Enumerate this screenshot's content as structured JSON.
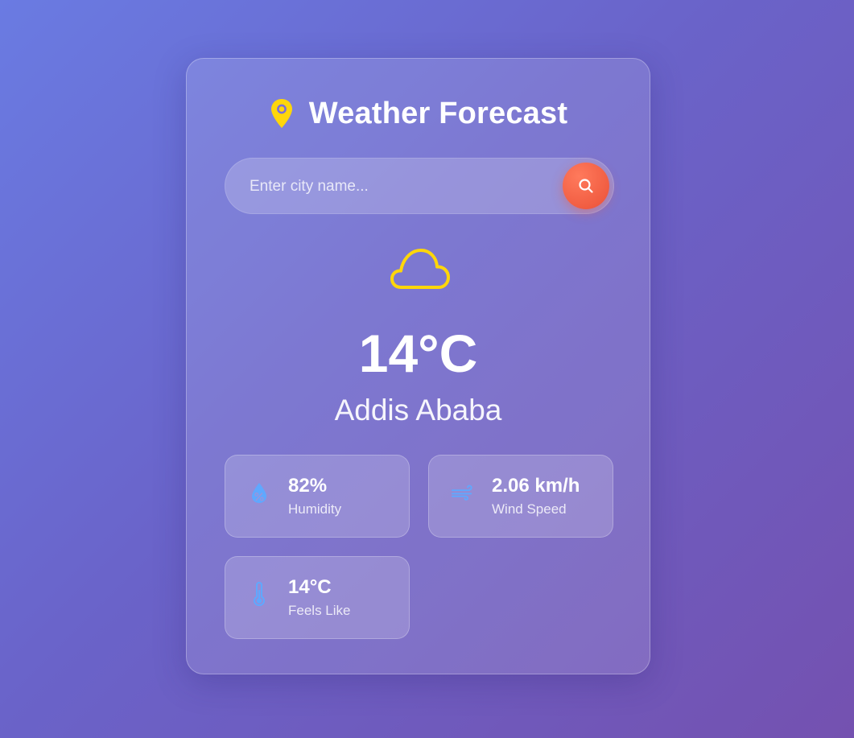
{
  "header": {
    "title": "Weather Forecast",
    "icon": "map-pin-icon",
    "icon_color": "#ffd60a"
  },
  "search": {
    "placeholder": "Enter city name...",
    "value": "",
    "button_icon": "search-icon",
    "button_color": "#f15d42"
  },
  "weather": {
    "condition_icon": "cloud-icon",
    "icon_color": "#ffd60a",
    "temperature": "14°C",
    "city": "Addis Ababa"
  },
  "stats": {
    "humidity": {
      "value": "82%",
      "label": "Humidity",
      "icon": "humidity-drop-icon"
    },
    "wind": {
      "value": "2.06 km/h",
      "label": "Wind Speed",
      "icon": "wind-icon"
    },
    "feels_like": {
      "value": "14°C",
      "label": "Feels Like",
      "icon": "thermometer-icon"
    },
    "icon_color": "#5fa8ff"
  }
}
